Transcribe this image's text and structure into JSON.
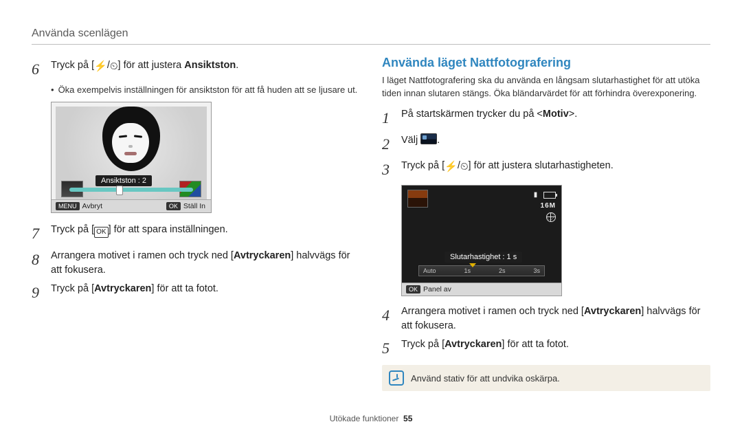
{
  "header": "Använda scenlägen",
  "left": {
    "steps": {
      "6": {
        "n": "6",
        "pre": "Tryck på [",
        "mid": "] för att justera ",
        "bold": "Ansiktston",
        "post": ".",
        "bullet": "Öka exempelvis inställningen för ansiktston för att få huden att se ljusare ut."
      },
      "7": {
        "n": "7",
        "pre": "Tryck på [",
        "post": "] för att spara inställningen."
      },
      "8": {
        "n": "8",
        "a": "Arrangera motivet i ramen och tryck ned [",
        "bold": "Avtryckaren",
        "b": "] halvvägs för att fokusera."
      },
      "9": {
        "n": "9",
        "a": "Tryck på [",
        "bold": "Avtryckaren",
        "b": "] för att ta fotot."
      }
    },
    "preview": {
      "slider_label": "Ansiktston : 2",
      "soft_menu": "MENU",
      "soft_menu_txt": "Avbryt",
      "soft_ok": "OK",
      "soft_ok_txt": "Ställ In"
    }
  },
  "right": {
    "title": "Använda läget Nattfotografering",
    "desc": "I läget Nattfotografering ska du använda en långsam slutarhastighet för att utöka tiden innan slutaren stängs. Öka bländarvärdet för att förhindra överexponering.",
    "steps": {
      "1": {
        "n": "1",
        "a": "På startskärmen trycker du på <",
        "bold": "Motiv",
        "b": ">."
      },
      "2": {
        "n": "2",
        "a": "Välj ",
        "b": "."
      },
      "3": {
        "n": "3",
        "a": "Tryck på [",
        "b": "] för att justera slutarhastigheten."
      },
      "4": {
        "n": "4",
        "a": "Arrangera motivet i ramen och tryck ned [",
        "bold": "Avtryckaren",
        "b": "] halvvägs för att fokusera."
      },
      "5": {
        "n": "5",
        "a": "Tryck på [",
        "bold": "Avtryckaren",
        "b": "] för att ta fotot."
      }
    },
    "preview": {
      "label": "Slutarhastighet : 1 s",
      "ticks": {
        "a": "Auto",
        "b": "1s",
        "c": "2s",
        "d": "3s"
      },
      "ind_res": "16M",
      "soft_ok": "OK",
      "soft_ok_txt": "Panel av"
    },
    "note": "Använd stativ för att undvika oskärpa."
  },
  "glyphs": {
    "flash": "⚡",
    "timer": "⏲",
    "sep": "/",
    "ok": "OK"
  },
  "footer": {
    "text": "Utökade funktioner",
    "page": "55"
  }
}
